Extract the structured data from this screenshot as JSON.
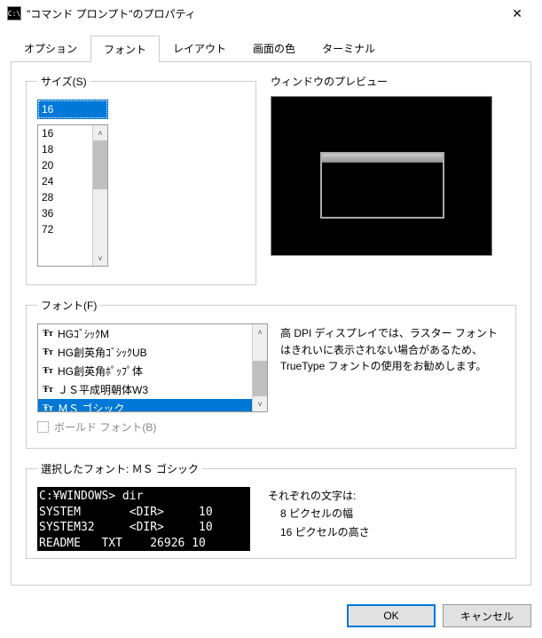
{
  "window": {
    "title": "\"コマンド プロンプト\"のプロパティ",
    "icon_text": "C:\\"
  },
  "tabs": {
    "options": "オプション",
    "font": "フォント",
    "layout": "レイアウト",
    "colors": "画面の色",
    "terminal": "ターミナル"
  },
  "size": {
    "legend": "サイズ(S)",
    "value": "16",
    "items": [
      "16",
      "18",
      "20",
      "24",
      "28",
      "36",
      "72"
    ]
  },
  "preview": {
    "label": "ウィンドウのプレビュー"
  },
  "font": {
    "legend": "フォント(F)",
    "items": [
      "HGｺﾞｼｯｸM",
      "HG創英角ｺﾞｼｯｸUB",
      "HG創英角ﾎﾟｯﾌﾟ体",
      "ＪＳ平成明朝体W3",
      "ＭＳ ゴシック"
    ],
    "selected_index": 4,
    "bold_label": "ボールド フォント(B)",
    "dpi_text": "高 DPI ディスプレイでは、ラスター フォントはきれいに表示されない場合があるため、TrueType フォントの使用をお勧めします。"
  },
  "selected": {
    "legend": "選択したフォント: ＭＳ ゴシック",
    "sample_lines": "C:¥WINDOWS> dir\nSYSTEM       <DIR>     10\nSYSTEM32     <DIR>     10\nREADME   TXT    26926 10",
    "char_label": "それぞれの文字は:",
    "char_w": "8 ピクセルの幅",
    "char_h": "16 ピクセルの高さ"
  },
  "buttons": {
    "ok": "OK",
    "cancel": "キャンセル"
  },
  "glyphs": {
    "close": "✕",
    "up": "˄",
    "down": "˅",
    "tt": "Ŧт"
  }
}
